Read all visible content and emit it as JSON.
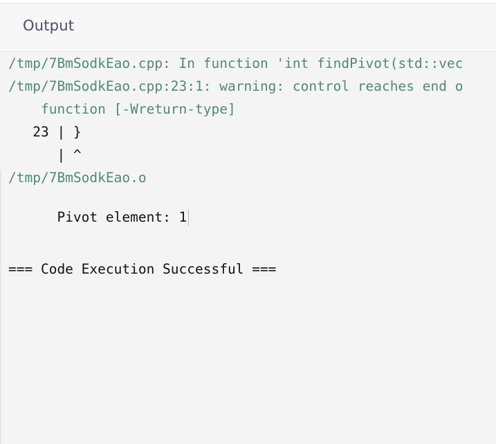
{
  "panel": {
    "title": "Output"
  },
  "console": {
    "lines": [
      "/tmp/7BmSodkEao.cpp: In function 'int findPivot(std::vec",
      "/tmp/7BmSodkEao.cpp:23:1: warning: control reaches end o",
      "    function [-Wreturn-type]",
      "   23 | }",
      "      | ^",
      "/tmp/7BmSodkEao.o",
      "Pivot element: 1",
      "=== Code Execution Successful ==="
    ]
  }
}
